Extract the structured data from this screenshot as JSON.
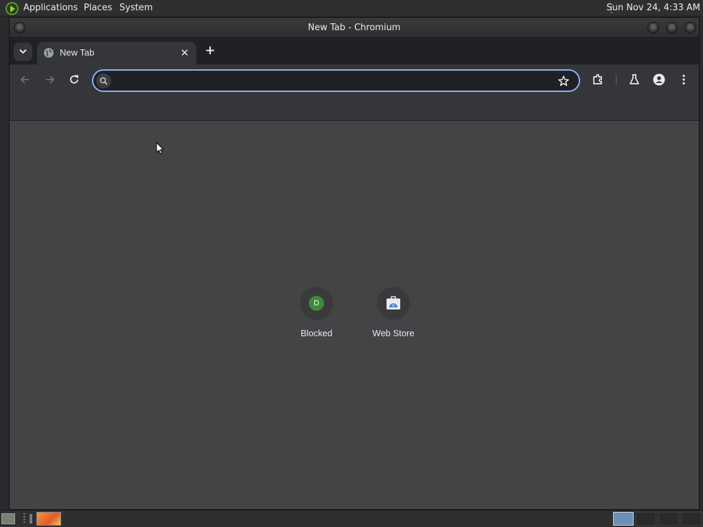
{
  "system_panel": {
    "menus": [
      "Applications",
      "Places",
      "System"
    ],
    "clock": "Sun Nov 24,  4:33 AM"
  },
  "window": {
    "title": "New Tab - Chromium"
  },
  "tabs": [
    {
      "title": "New Tab",
      "favicon": "globe-icon",
      "active": true
    }
  ],
  "toolbar": {
    "omnibox_value": "",
    "omnibox_placeholder": "",
    "icons": [
      "back-icon",
      "forward-icon",
      "reload-icon",
      "bookmark-star-icon",
      "extensions-icon",
      "labs-icon",
      "profile-icon",
      "menu-icon"
    ]
  },
  "shortcuts": [
    {
      "label": "Blocked",
      "letter": "D",
      "color": "#3d8a3a"
    },
    {
      "label": "Web Store",
      "icon": "web-store-icon"
    }
  ],
  "colors": {
    "accent": "#8ab4f8",
    "tab_strip": "#202124",
    "toolbar": "#35363a",
    "content": "#444447"
  }
}
